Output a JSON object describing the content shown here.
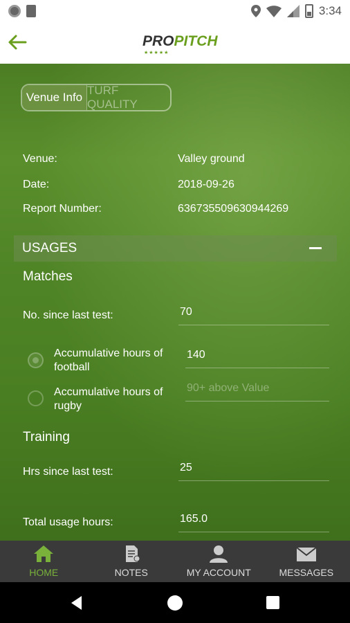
{
  "status_bar": {
    "time": "3:34",
    "left_icons": [
      "circle-notification-icon",
      "sd-card-icon"
    ],
    "right_icons": [
      "location-pin-icon",
      "wifi-icon",
      "cell-signal-icon",
      "battery-icon"
    ]
  },
  "app_bar": {
    "back_icon": "arrow-left-icon",
    "logo_pro": "PRO",
    "logo_pitch": "PITCH",
    "logo_stars": "★★★★★",
    "accent_color": "#6a9f1e"
  },
  "tabs": [
    {
      "label": "Venue Info",
      "active": true
    },
    {
      "label": "TURF QUALITY",
      "active": false
    }
  ],
  "venue_info": {
    "venue_label": "Venue:",
    "venue_value": "Valley ground",
    "date_label": "Date:",
    "date_value": "2018-09-26",
    "report_label": "Report Number:",
    "report_value": "636735509630944269"
  },
  "usages": {
    "section_title": "USAGES",
    "collapse_icon": "minus-icon",
    "matches_heading": "Matches",
    "since_last_test_label": "No. since last test:",
    "since_last_test_value": "70",
    "options": [
      {
        "label": "Accumulative hours of football",
        "value": "140",
        "placeholder": "",
        "selected": true
      },
      {
        "label": "Accumulative hours of rugby",
        "value": "",
        "placeholder": "90+ above Value",
        "selected": false
      }
    ],
    "training_heading": "Training",
    "hrs_since_label": "Hrs since last test:",
    "hrs_since_value": "25",
    "total_label": "Total usage hours:",
    "total_value": "165.0"
  },
  "bottom_nav": [
    {
      "label": "HOME",
      "icon": "home-icon",
      "active": true
    },
    {
      "label": "NOTES",
      "icon": "notes-icon",
      "active": false
    },
    {
      "label": "MY ACCOUNT",
      "icon": "account-icon",
      "active": false
    },
    {
      "label": "MESSAGES",
      "icon": "envelope-icon",
      "active": false
    }
  ],
  "colors": {
    "active_nav": "#79b13a",
    "nav_bg": "#3a3a3a",
    "content_green": "#4f8426"
  }
}
